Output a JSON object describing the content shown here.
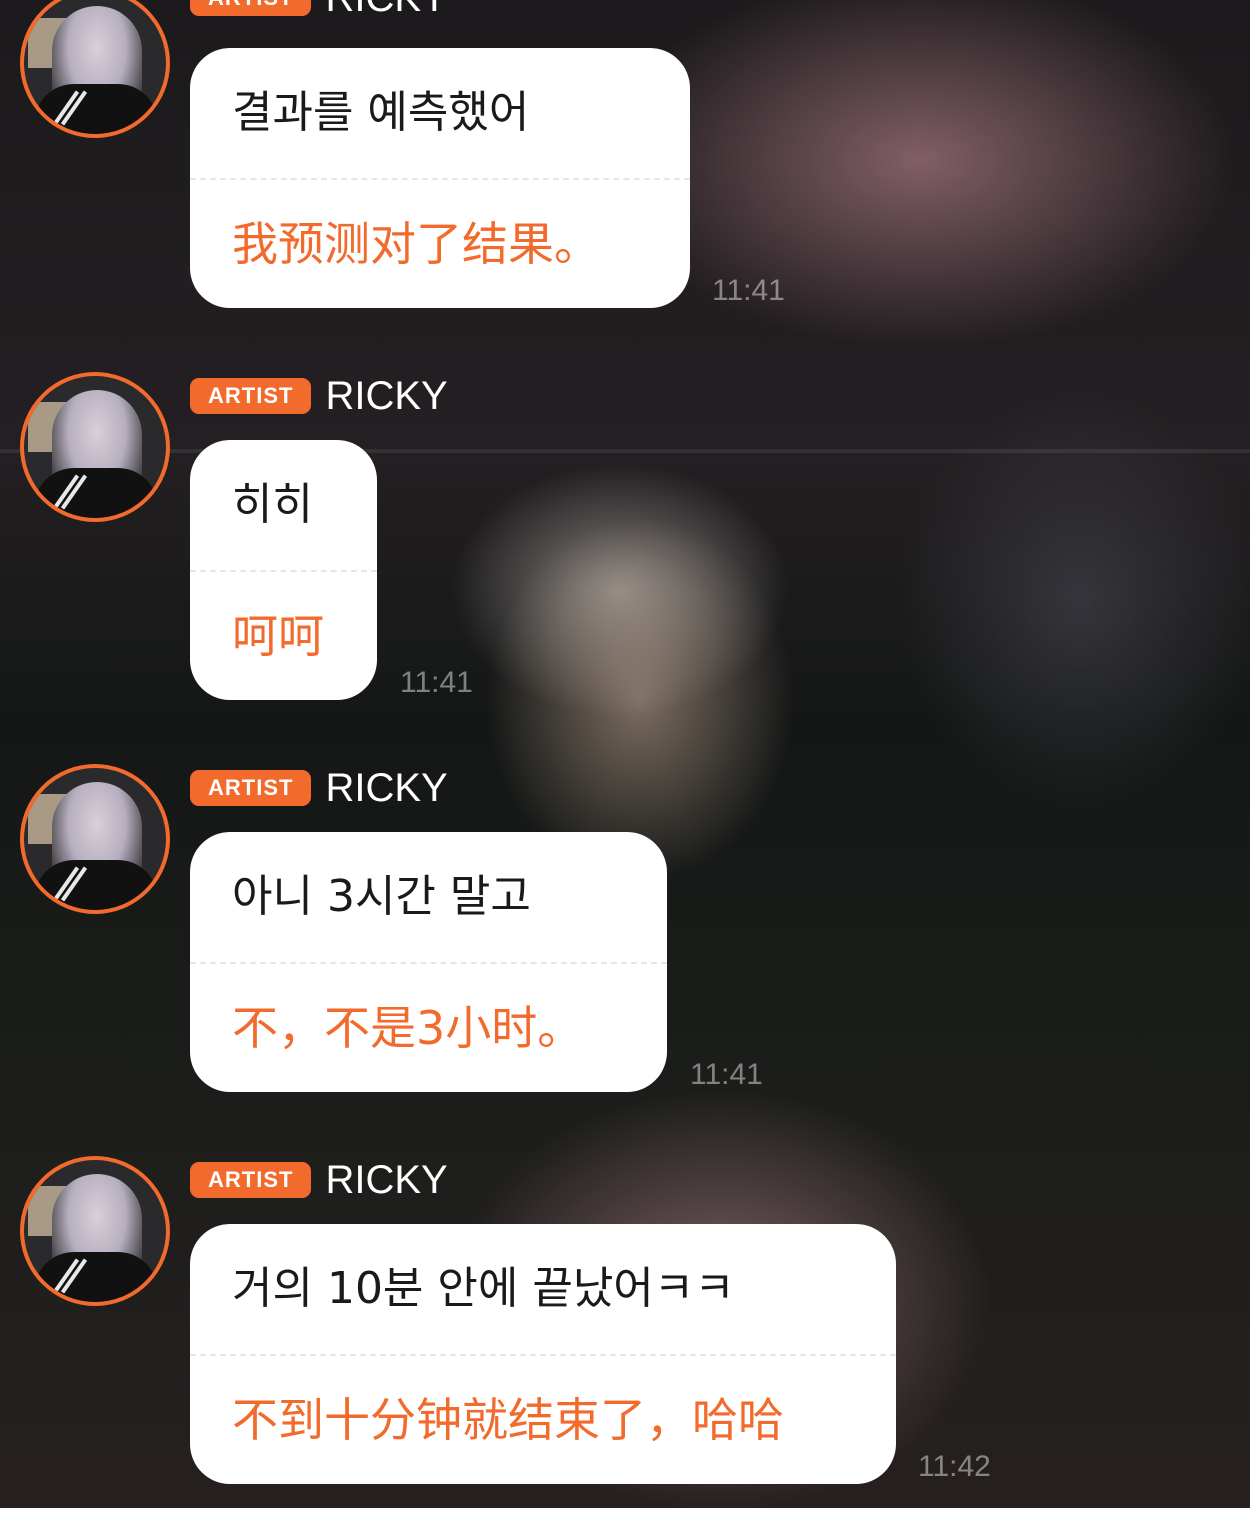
{
  "colors": {
    "accent": "#f26a2c",
    "bubble_bg": "#ffffff",
    "korean_text": "#1a1a1a",
    "chinese_text": "#f26a2c"
  },
  "messages": [
    {
      "badge": "ARTIST",
      "name": "RICKY",
      "korean": "결과를 예측했어",
      "chinese": "我预测对了结果。",
      "time": "11:41"
    },
    {
      "badge": "ARTIST",
      "name": "RICKY",
      "korean": "히히",
      "chinese": "呵呵",
      "time": "11:41"
    },
    {
      "badge": "ARTIST",
      "name": "RICKY",
      "korean": "아니 3시간 말고",
      "chinese": "不，不是3小时。",
      "time": "11:41"
    },
    {
      "badge": "ARTIST",
      "name": "RICKY",
      "korean": "거의 10분 안에 끝났어ㅋㅋ",
      "chinese": "不到十分钟就结束了，哈哈",
      "time": "11:42"
    }
  ]
}
